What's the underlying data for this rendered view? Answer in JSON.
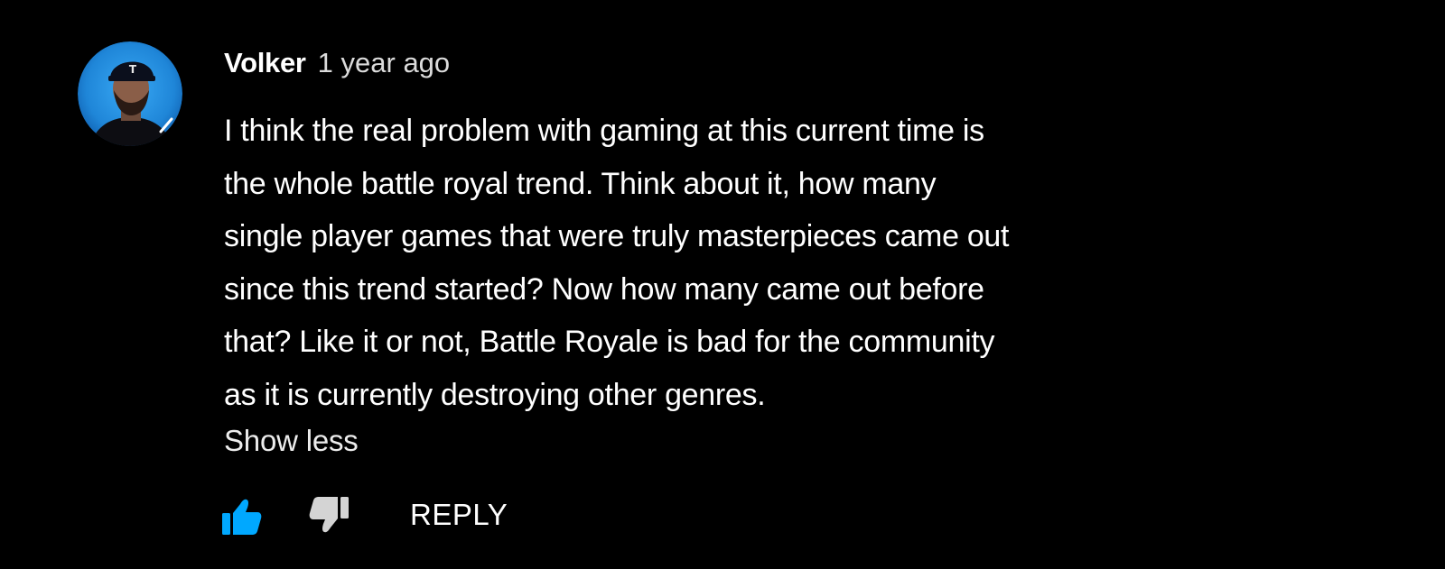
{
  "comment": {
    "author": "Volker",
    "timestamp": "1 year ago",
    "text_lines": [
      "I think the real problem with gaming at this current time is",
      "the whole battle royal trend. Think about it, how many",
      "single player games that were truly masterpieces came out",
      "since this trend started? Now how many came out before",
      "that? Like it or not, Battle Royale is bad for the community",
      "as it is currently destroying other genres."
    ],
    "show_less_label": "Show less",
    "reply_label": "REPLY",
    "like_state": "active"
  },
  "colors": {
    "background": "#000000",
    "text": "#ffffff",
    "like_active": "#00a8ff",
    "dislike": "#d0d0d0",
    "avatar_bg": "#1f8fe0"
  },
  "icons": {
    "avatar": "user-avatar",
    "like": "thumbs-up-icon",
    "dislike": "thumbs-down-icon"
  }
}
